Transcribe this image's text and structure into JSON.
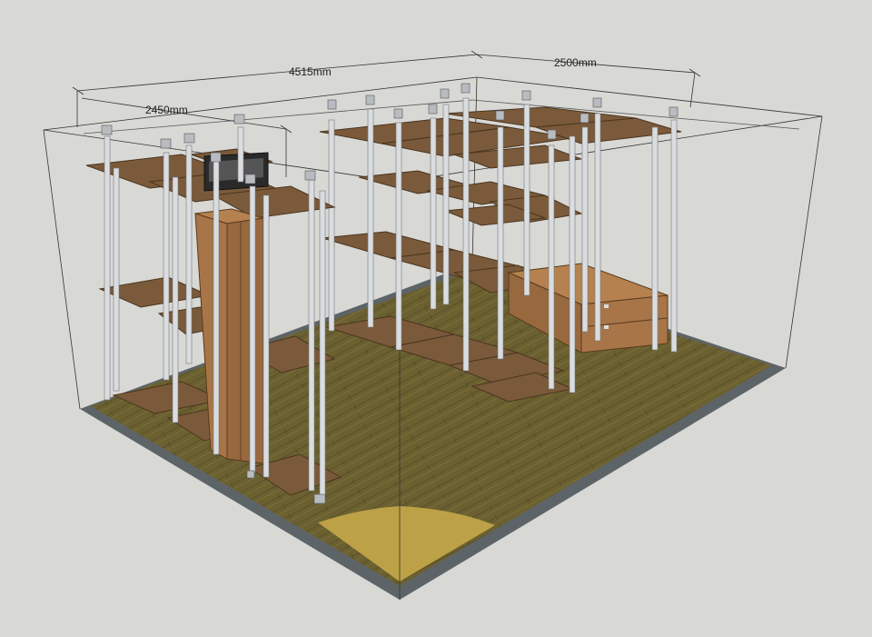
{
  "dimensions": {
    "total_width": "4515mm",
    "right_depth": "2500mm",
    "left_depth": "2450mm"
  },
  "colors": {
    "background": "#d8d8d5",
    "floor": "#6b6030",
    "floor_edge": "#5d6468",
    "shelf": "#7a5a3a",
    "shelf_edge": "#4a3520",
    "post": "#d9dde0",
    "cabinet": "#a87548",
    "door_swing": "#c7a84a"
  }
}
